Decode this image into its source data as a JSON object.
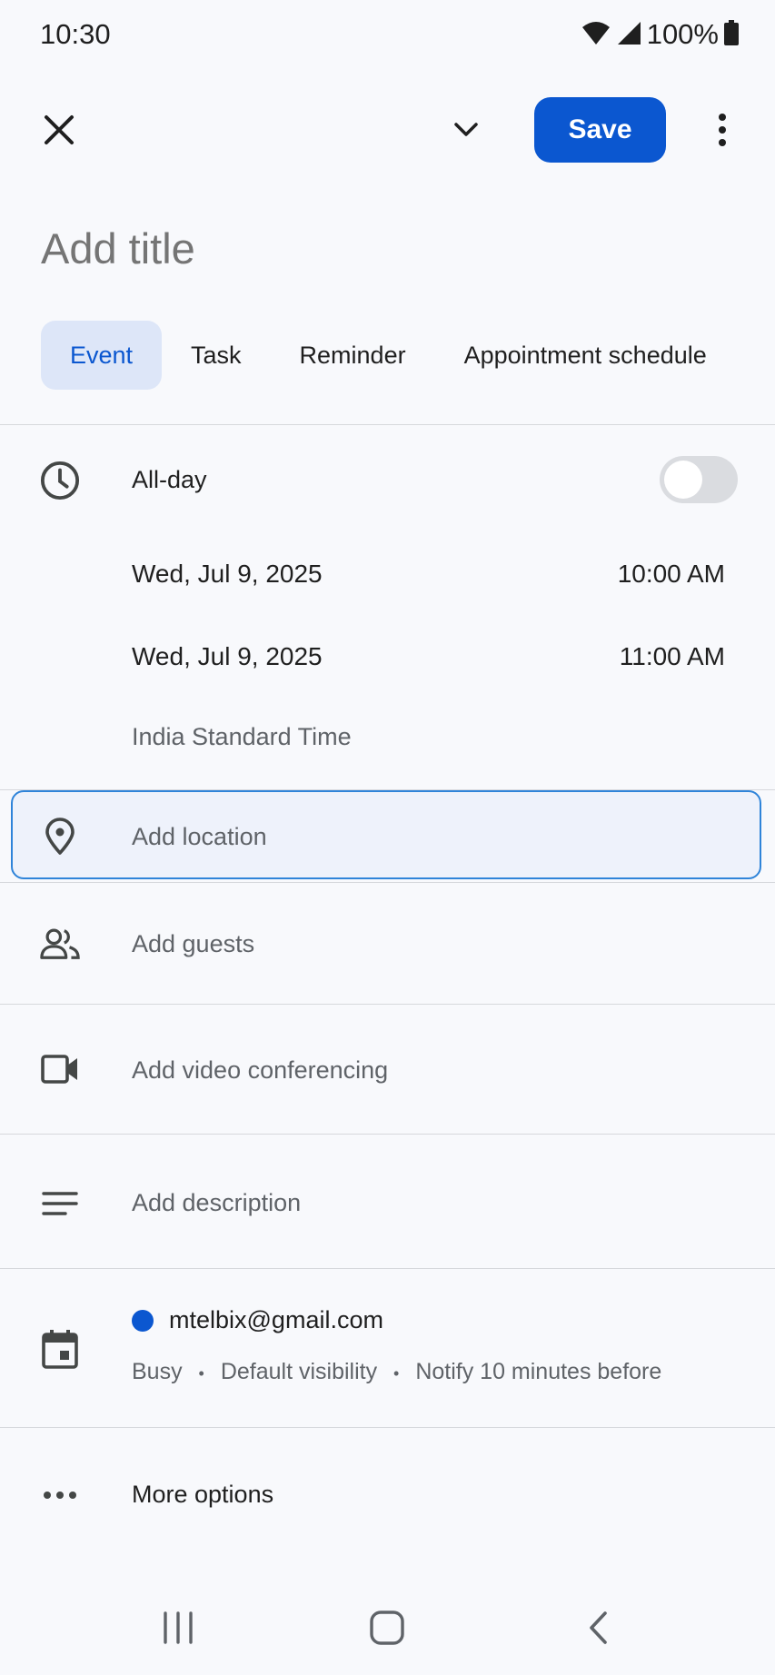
{
  "status_bar": {
    "time": "10:30",
    "battery": "100%"
  },
  "toolbar": {
    "save_label": "Save"
  },
  "title": {
    "placeholder": "Add title"
  },
  "tabs": [
    {
      "label": "Event",
      "active": true
    },
    {
      "label": "Task",
      "active": false
    },
    {
      "label": "Reminder",
      "active": false
    },
    {
      "label": "Appointment schedule",
      "active": false
    }
  ],
  "time_section": {
    "all_day_label": "All-day",
    "all_day_enabled": false,
    "start_date": "Wed, Jul 9, 2025",
    "start_time": "10:00 AM",
    "end_date": "Wed, Jul 9, 2025",
    "end_time": "11:00 AM",
    "timezone": "India Standard Time"
  },
  "fields": {
    "location_placeholder": "Add location",
    "guests_placeholder": "Add guests",
    "video_label": "Add video conferencing",
    "description_placeholder": "Add description"
  },
  "calendar_account": {
    "email": "mtelbix@gmail.com",
    "color": "#0b57d0",
    "status": "Busy",
    "visibility": "Default visibility",
    "notification": "Notify 10 minutes before",
    "separator": "•"
  },
  "more_options_label": "More options",
  "colors": {
    "accent": "#0b57d0",
    "background": "#f8f9fc",
    "active_tab_bg": "#dde6f8",
    "focus_border": "#2f84d9"
  }
}
